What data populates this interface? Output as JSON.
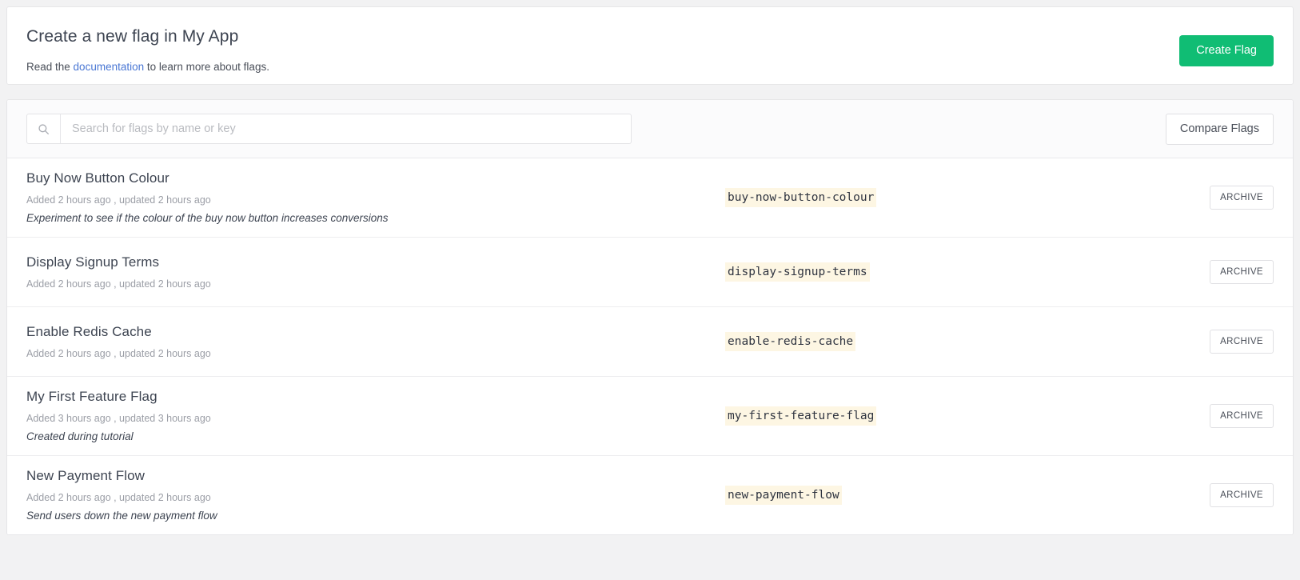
{
  "header": {
    "title": "Create a new flag in My App",
    "subtitle_before": "Read the ",
    "doc_link_label": "documentation",
    "subtitle_after": " to learn more about flags.",
    "create_button_label": "Create Flag",
    "accent_color": "#10bd74",
    "link_color": "#4a77d4"
  },
  "toolbar": {
    "search_placeholder": "Search for flags by name or key",
    "search_value": "",
    "search_icon": "search-icon",
    "compare_button_label": "Compare Flags"
  },
  "flags": [
    {
      "name": "Buy Now Button Colour",
      "meta": "Added 2 hours ago , updated 2 hours ago",
      "description": "Experiment to see if the colour of the buy now button increases conversions",
      "key": "buy-now-button-colour",
      "action_label": "ARCHIVE"
    },
    {
      "name": "Display Signup Terms",
      "meta": "Added 2 hours ago , updated 2 hours ago",
      "description": "",
      "key": "display-signup-terms",
      "action_label": "ARCHIVE"
    },
    {
      "name": "Enable Redis Cache",
      "meta": "Added 2 hours ago , updated 2 hours ago",
      "description": "",
      "key": "enable-redis-cache",
      "action_label": "ARCHIVE"
    },
    {
      "name": "My First Feature Flag",
      "meta": "Added 3 hours ago , updated 3 hours ago",
      "description": "Created during tutorial",
      "key": "my-first-feature-flag",
      "action_label": "ARCHIVE"
    },
    {
      "name": "New Payment Flow",
      "meta": "Added 2 hours ago , updated 2 hours ago",
      "description": "Send users down the new payment flow",
      "key": "new-payment-flow",
      "action_label": "ARCHIVE"
    }
  ]
}
